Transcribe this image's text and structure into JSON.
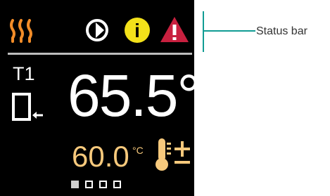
{
  "colors": {
    "background": "#000000",
    "primary_text": "#ffffff",
    "heating": "#f28c28",
    "info": "#f3e11a",
    "warning": "#c8203f",
    "setpoint": "#f7c97c",
    "divider": "#bdbdbd",
    "callout": "#119c94",
    "dot_active": "#cfcfcf",
    "dot_inactive": "#ffffff"
  },
  "status_bar": {
    "icons": [
      "heating-icon",
      "fan-icon",
      "info-icon",
      "warning-icon"
    ],
    "info_glyph": "i",
    "warning_glyph": "!"
  },
  "sensor": {
    "label": "T1",
    "mode_icon": "mode-icon"
  },
  "reading": {
    "value": "65.5°"
  },
  "setpoint": {
    "value": "60.0",
    "unit": "°C",
    "adjust_icon": "thermometer-adjust-icon"
  },
  "pagination": {
    "total": 4,
    "active_index": 0
  },
  "annotation": {
    "label": "Status bar"
  }
}
